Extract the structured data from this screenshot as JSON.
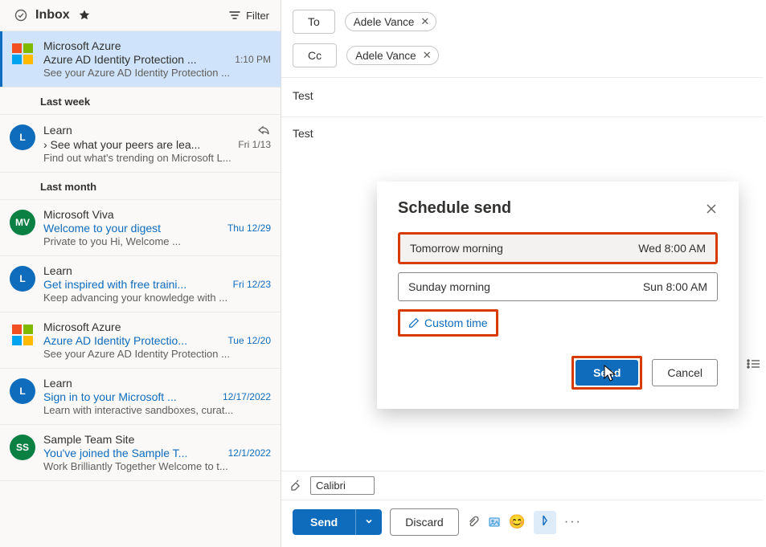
{
  "header": {
    "title": "Inbox",
    "filter_label": "Filter"
  },
  "sections": [
    {
      "items": [
        {
          "sender": "Microsoft Azure",
          "subject": "Azure AD Identity Protection ...",
          "time": "1:10 PM",
          "preview": "See your Azure AD Identity Protection ...",
          "avatar_type": "ms",
          "selected": true
        }
      ]
    },
    {
      "label": "Last week",
      "items": [
        {
          "sender": "Learn",
          "subject": "See what your peers are lea...",
          "subject_prefix": "›  ",
          "time": "Fri 1/13",
          "preview": "Find out what's trending on Microsoft L...",
          "avatar_type": "initial",
          "avatar_text": "L",
          "avatar_color": "#0f6cbd",
          "show_reply_icon": true
        }
      ]
    },
    {
      "label": "Last month",
      "items": [
        {
          "sender": "Microsoft Viva",
          "subject": "Welcome to your digest",
          "time": "Thu 12/29",
          "preview": "Private to you Hi,               Welcome ...",
          "avatar_type": "initial",
          "avatar_text": "MV",
          "avatar_color": "#0b8043",
          "link": true
        },
        {
          "sender": "Learn",
          "subject": "Get inspired with free traini...",
          "time": "Fri 12/23",
          "preview": "Keep advancing your knowledge with ...",
          "avatar_type": "initial",
          "avatar_text": "L",
          "avatar_color": "#0f6cbd",
          "link": true
        },
        {
          "sender": "Microsoft Azure",
          "subject": "Azure AD Identity Protectio...",
          "time": "Tue 12/20",
          "preview": "See your Azure AD Identity Protection ...",
          "avatar_type": "ms",
          "link": true
        },
        {
          "sender": "Learn",
          "subject": "Sign in to your Microsoft ...",
          "time": "12/17/2022",
          "preview": "Learn with interactive sandboxes, curat...",
          "avatar_type": "initial",
          "avatar_text": "L",
          "avatar_color": "#0f6cbd",
          "link": true
        },
        {
          "sender": "Sample Team Site",
          "subject": "You've joined the Sample T...",
          "time": "12/1/2022",
          "preview": "Work Brilliantly Together Welcome to t...",
          "avatar_type": "initial",
          "avatar_text": "SS",
          "avatar_color": "#0b8043",
          "link": true
        }
      ]
    }
  ],
  "compose": {
    "to_label": "To",
    "cc_label": "Cc",
    "to_chip": "Adele Vance",
    "cc_chip": "Adele Vance",
    "subject_value": "Test",
    "body_value": "Test",
    "font_name": "Calibri",
    "send_label": "Send",
    "discard_label": "Discard"
  },
  "modal": {
    "title": "Schedule send",
    "option1_label": "Tomorrow morning",
    "option1_time": "Wed 8:00 AM",
    "option2_label": "Sunday morning",
    "option2_time": "Sun 8:00 AM",
    "custom_label": "Custom time",
    "send_label": "Send",
    "cancel_label": "Cancel"
  }
}
